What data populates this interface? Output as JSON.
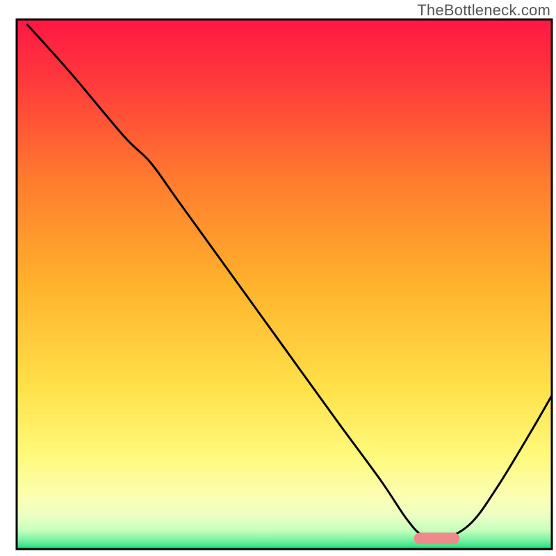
{
  "watermark": "TheBottleneck.com",
  "chart_data": {
    "type": "line",
    "title": "",
    "xlabel": "",
    "ylabel": "",
    "xlim": [
      0,
      100
    ],
    "ylim": [
      0,
      100
    ],
    "background_gradient_stops": [
      {
        "offset": 0.0,
        "color": "#ff1744"
      },
      {
        "offset": 0.12,
        "color": "#ff3b3b"
      },
      {
        "offset": 0.3,
        "color": "#ff7a2e"
      },
      {
        "offset": 0.5,
        "color": "#ffb22c"
      },
      {
        "offset": 0.7,
        "color": "#ffe24a"
      },
      {
        "offset": 0.82,
        "color": "#fff97a"
      },
      {
        "offset": 0.905,
        "color": "#fbffb5"
      },
      {
        "offset": 0.94,
        "color": "#e9ffc4"
      },
      {
        "offset": 0.965,
        "color": "#c4ffbb"
      },
      {
        "offset": 0.985,
        "color": "#72f0a0"
      },
      {
        "offset": 1.0,
        "color": "#12e07b"
      }
    ],
    "border_color": "#000000",
    "series": [
      {
        "name": "bottleneck-curve",
        "stroke": "#000000",
        "stroke_width": 3,
        "x": [
          2.0,
          10.0,
          20.0,
          25.0,
          30.0,
          40.0,
          50.0,
          60.0,
          68.0,
          73.0,
          76.0,
          80.0,
          85.0,
          90.0,
          96.0,
          100.0
        ],
        "values": [
          99.0,
          90.0,
          78.0,
          73.0,
          66.0,
          52.0,
          38.0,
          24.0,
          13.0,
          5.5,
          2.5,
          2.0,
          5.0,
          12.0,
          22.0,
          29.0
        ]
      }
    ],
    "annotations": [
      {
        "name": "optimal-marker",
        "shape": "rounded-rect",
        "fill": "#f08a8a",
        "x_center": 78.5,
        "y_center": 2.0,
        "width": 8.5,
        "height": 2.2,
        "rx": 1.1
      }
    ]
  }
}
